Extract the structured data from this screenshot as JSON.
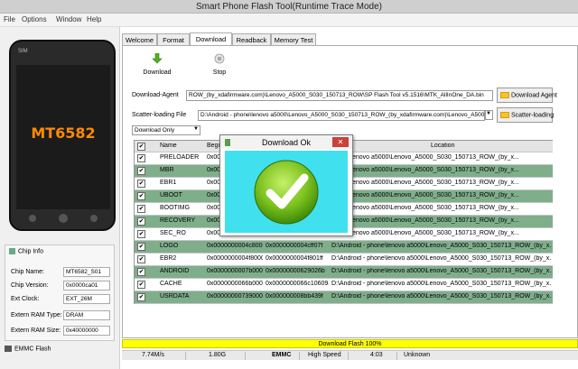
{
  "window": {
    "title": "Smart Phone Flash Tool(Runtime Trace Mode)"
  },
  "menu": [
    "File",
    "Options",
    "Window",
    "Help"
  ],
  "phone": {
    "chip_label": "MT6582"
  },
  "chip_info": {
    "header": "Chip Info",
    "fields": [
      {
        "label": "Chip Name:",
        "value": "MT6582_S01"
      },
      {
        "label": "Chip Version:",
        "value": "0x0000ca01"
      },
      {
        "label": "Ext Clock:",
        "value": "EXT_26M"
      },
      {
        "label": "Extern RAM Type:",
        "value": "DRAM"
      },
      {
        "label": "Extern RAM Size:",
        "value": "0x40000000"
      }
    ]
  },
  "storage_label": "EMMC Flash",
  "tabs": [
    "Welcome",
    "Format",
    "Download",
    "Readback",
    "Memory Test"
  ],
  "active_tab": "Download",
  "toolbar": {
    "download_label": "Download",
    "stop_label": "Stop"
  },
  "download_agent": {
    "label": "Download-Agent",
    "path": "ROW_(by_xdafirmware.com)\\Lenovo_A5000_S030_150713_ROW\\SP Flash Tool v5.1516\\MTK_AllInOne_DA.bin",
    "button": "Download Agent"
  },
  "scatter": {
    "label": "Scatter-loading File",
    "path": "D:\\Android - phone\\lenovo a5000\\Lenovo_A5000_S030_150713_ROW_(by_xdafirmware.com)\\Lenovo_A500",
    "button": "Scatter-loading"
  },
  "mode_select": "Download Only",
  "table": {
    "columns": [
      "Name",
      "Begin A",
      "",
      "Location"
    ],
    "rows": [
      {
        "name": "PRELOADER",
        "begin": "0x000000",
        "end": "",
        "location": "phone\\lenovo a5000\\Lenovo_A5000_S030_150713_ROW_(by_x..."
      },
      {
        "name": "MBR",
        "begin": "0x000000",
        "end": "",
        "location": "phone\\lenovo a5000\\Lenovo_A5000_S030_150713_ROW_(by_x..."
      },
      {
        "name": "EBR1",
        "begin": "0x000000",
        "end": "",
        "location": "phone\\lenovo a5000\\Lenovo_A5000_S030_150713_ROW_(by_x..."
      },
      {
        "name": "UBOOT",
        "begin": "0x000000",
        "end": "",
        "location": "phone\\lenovo a5000\\Lenovo_A5000_S030_150713_ROW_(by_x..."
      },
      {
        "name": "BOOTIMG",
        "begin": "0x000000",
        "end": "",
        "location": "phone\\lenovo a5000\\Lenovo_A5000_S030_150713_ROW_(by_x..."
      },
      {
        "name": "RECOVERY",
        "begin": "0x000000",
        "end": "",
        "location": "phone\\lenovo a5000\\Lenovo_A5000_S030_150713_ROW_(by_x..."
      },
      {
        "name": "SEC_RO",
        "begin": "0x000000",
        "end": "",
        "location": "phone\\lenovo a5000\\Lenovo_A5000_S030_150713_ROW_(by_x..."
      },
      {
        "name": "LOGO",
        "begin": "0x0000000004c80000",
        "end": "0x0000000004cff07f",
        "location": "D:\\Android - phone\\lenovo a5000\\Lenovo_A5000_S030_150713_ROW_(by_x..."
      },
      {
        "name": "EBR2",
        "begin": "0x0000000004f80000",
        "end": "0x0000000004f801ff",
        "location": "D:\\Android - phone\\lenovo a5000\\Lenovo_A5000_S030_150713_ROW_(by_x..."
      },
      {
        "name": "ANDROID",
        "begin": "0x0000000007b00000",
        "end": "0x00000000629026b",
        "location": "D:\\Android - phone\\lenovo a5000\\Lenovo_A5000_S030_150713_ROW_(by_x..."
      },
      {
        "name": "CACHE",
        "begin": "0x0000000066b00000",
        "end": "0x0000000066c106093",
        "location": "D:\\Android - phone\\lenovo a5000\\Lenovo_A5000_S030_150713_ROW_(by_x..."
      },
      {
        "name": "USRDATA",
        "begin": "0x0000000073900000",
        "end": "0x000000008bb439f",
        "location": "D:\\Android - phone\\lenovo a5000\\Lenovo_A5000_S030_150713_ROW_(by_x..."
      }
    ]
  },
  "dialog": {
    "title": "Download Ok",
    "close": "✕"
  },
  "progress": {
    "label": "Download Flash 100%",
    "fraction": 1.0
  },
  "status": {
    "speed": "7.74M/s",
    "size": "1.80G",
    "storage": "EMMC",
    "usb": "High Speed",
    "time": "4:03",
    "other": "Unknown"
  },
  "colors": {
    "row_highlight": "#7fae8b",
    "dialog_body": "#40e0ef",
    "check_circle": "#7cc11e",
    "progress_fill": "#ffff00",
    "chip_label": "#ff8a00"
  }
}
